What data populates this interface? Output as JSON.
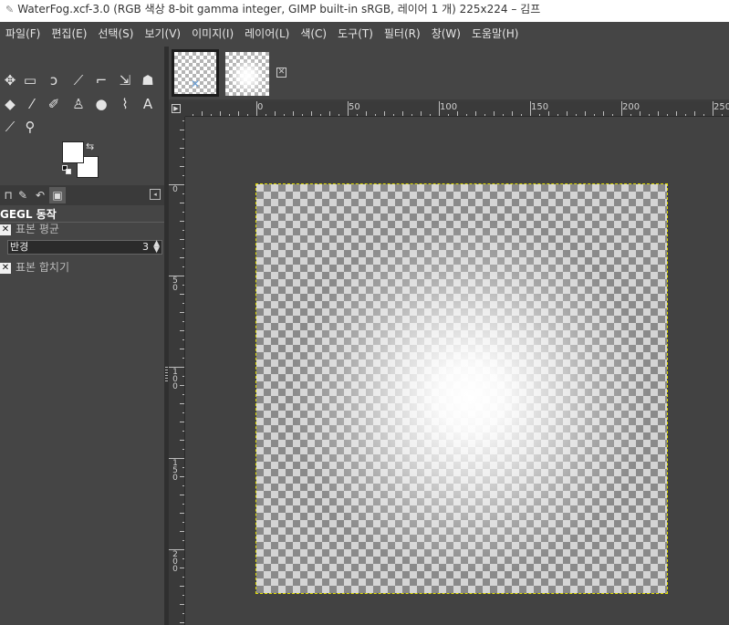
{
  "window": {
    "title": "WaterFog.xcf-3.0 (RGB 색상 8-bit gamma integer, GIMP built-in sRGB, 레이어 1 개) 225x224 – 김프"
  },
  "menu": [
    "파일(F)",
    "편집(E)",
    "선택(S)",
    "보기(V)",
    "이미지(I)",
    "레이어(L)",
    "색(C)",
    "도구(T)",
    "필터(R)",
    "창(W)",
    "도움말(H)"
  ],
  "tools": {
    "icons": [
      "move-tool-icon",
      "rect-select-icon",
      "lasso-select-icon",
      "fuzzy-select-icon",
      "crop-icon",
      "unified-transform-icon",
      "warp-transform-icon",
      "bucket-fill-icon",
      "paintbrush-icon",
      "eraser-icon",
      "clone-icon",
      "smudge-icon",
      "paths-icon",
      "text-tool-icon",
      "color-picker-icon",
      "zoom-tool-icon"
    ]
  },
  "colors": {
    "foreground": "#ffffff",
    "background": "#ffffff",
    "selection_outline": "#e4e000"
  },
  "dock_tabs": [
    "tool-options-tab",
    "device-status-tab",
    "undo-history-tab",
    "images-tab"
  ],
  "tool_options": {
    "title": "GEGL 동작",
    "sample_average_label": "표본 평균",
    "radius_label": "반경",
    "radius_value": "3",
    "sample_merged_label": "표본 합치기"
  },
  "rulers": {
    "horizontal": [
      "0",
      "50",
      "100",
      "150",
      "200",
      "250"
    ],
    "vertical": [
      "0",
      "50",
      "100",
      "150",
      "200"
    ]
  },
  "image": {
    "name": "WaterFog.xcf",
    "width": 225,
    "height": 224
  }
}
